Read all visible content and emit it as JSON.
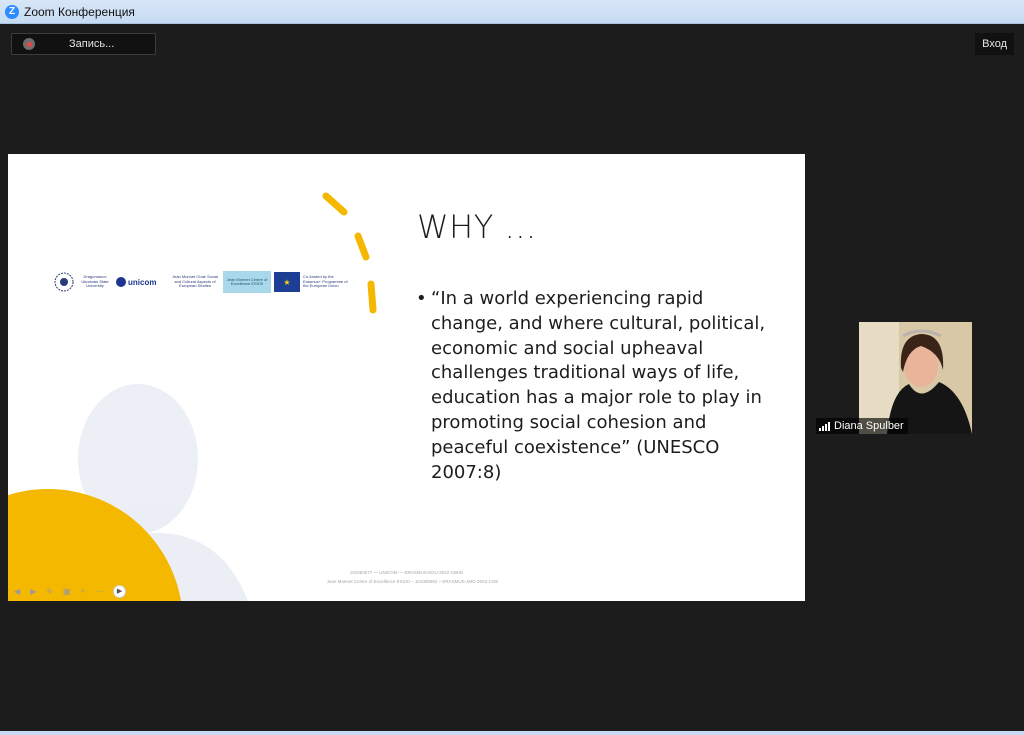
{
  "window": {
    "app_icon_letter": "Z",
    "title": "Zoom Конференция"
  },
  "toolbar": {
    "recording_label": "Запись...",
    "enter_label": "Вход"
  },
  "slide": {
    "title": "WHY …",
    "bullet_marker": "•",
    "bullet_text": "“In a world experiencing rapid change, and where cultural, political, economic and social upheaval challenges traditional ways of life, education has a major role to play in promoting social cohesion and peaceful coexistence” (UNESCO 2007:8)",
    "logos": {
      "university": "Dragomanov Ukrainian State University",
      "unicom": "unicom",
      "jean_monnet_chair": "Jean Monnet Chair Social and Cultural Aspects of European Studies",
      "esss_title": "Jean Monnet Centre of Excellence ESSSI",
      "erasmus_text": "Co-funded by the Erasmus+ Programme of the European Union"
    },
    "footer_line1": "101083077 — UNICOM — ERASMUS-EDU-2022-CBHE",
    "footer_line2": "Jean Monnet Centre of Excellence ESSSI – 101085552 – ERASMUS-JMO-2022-COE"
  },
  "participant": {
    "name": "Diana Spulber"
  },
  "colors": {
    "accent_yellow": "#f5b800",
    "zoom_blue": "#2d8cff"
  }
}
